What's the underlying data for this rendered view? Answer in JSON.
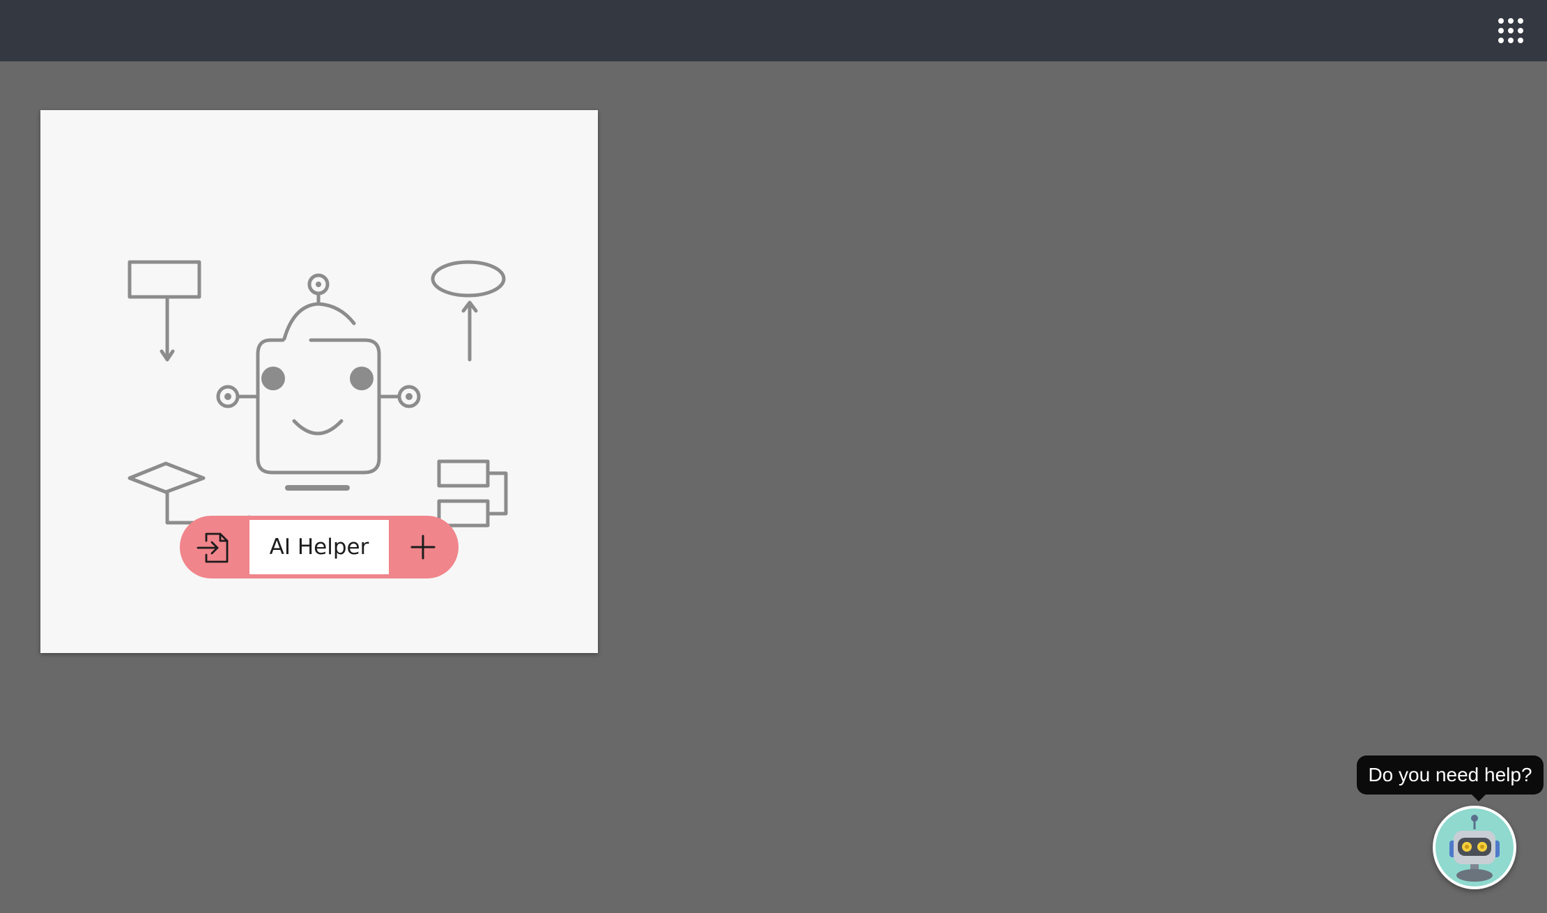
{
  "topbar": {
    "apps_icon": "grid-dots-icon"
  },
  "card": {
    "illustration": "robot-flowchart-illustration",
    "action_pill": {
      "label": "AI Helper",
      "left_icon": "file-import-icon",
      "right_icon": "plus-icon",
      "color": "#f0858b"
    }
  },
  "assistant": {
    "tooltip": "Do you need help?",
    "icon": "robot-avatar-icon"
  },
  "colors": {
    "topbar": "#343841",
    "background": "#696969",
    "card": "#f7f7f7",
    "illustration_stroke": "#8c8c8c"
  }
}
